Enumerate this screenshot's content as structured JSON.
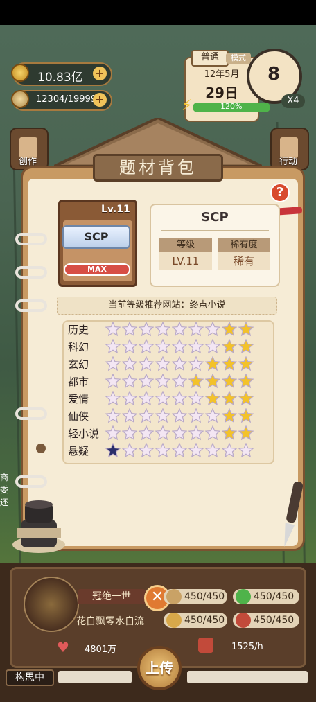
{
  "hud": {
    "money": "10.83亿",
    "fans": "12304/19999",
    "plus": "+",
    "calendar_mode": "普通",
    "calendar_tag": "模式",
    "date_month": "12年5月",
    "date_day": "29日",
    "energy_percent": "120%",
    "energy_value": 1.0,
    "clock_number": "8",
    "multiplier": "X4"
  },
  "side": {
    "left_label": "创作",
    "right_label": "行动"
  },
  "notebook": {
    "title": "题材背包",
    "help_symbol": "?",
    "card": {
      "level": "Lv.11",
      "name": "SCP",
      "max_label": "MAX"
    },
    "info": {
      "title": "SCP",
      "level_header": "等级",
      "level_value": "LV.11",
      "rarity_header": "稀有度",
      "rarity_value": "稀有"
    },
    "recommend": "当前等级推荐网站：终点小说",
    "genres": [
      {
        "name": "历史",
        "gold": 2,
        "dark": 0
      },
      {
        "name": "科幻",
        "gold": 2,
        "dark": 0
      },
      {
        "name": "玄幻",
        "gold": 3,
        "dark": 0
      },
      {
        "name": "都市",
        "gold": 4,
        "dark": 0
      },
      {
        "name": "爱情",
        "gold": 3,
        "dark": 0
      },
      {
        "name": "仙侠",
        "gold": 2,
        "dark": 0
      },
      {
        "name": "轻小说",
        "gold": 2,
        "dark": 0
      },
      {
        "name": "悬疑",
        "gold": 0,
        "dark": 1
      }
    ],
    "stars_per_row": 9
  },
  "left_clip": "商\n委\n还",
  "bottom": {
    "title_banner": "冠绝一世",
    "motto": "花自飘零水自流",
    "res1": "450/450",
    "res2": "450/450",
    "res3": "450/450",
    "res4": "450/450",
    "likes": "4801万",
    "rate": "1525/h",
    "upload": "上传",
    "thinking": "构思中",
    "x_symbol": "✕"
  },
  "colors": {
    "star_gold": "#f3c22a",
    "star_pale": "#f3e6f3",
    "star_dark": "#2a2e6a",
    "accent_red": "#d74e45"
  }
}
